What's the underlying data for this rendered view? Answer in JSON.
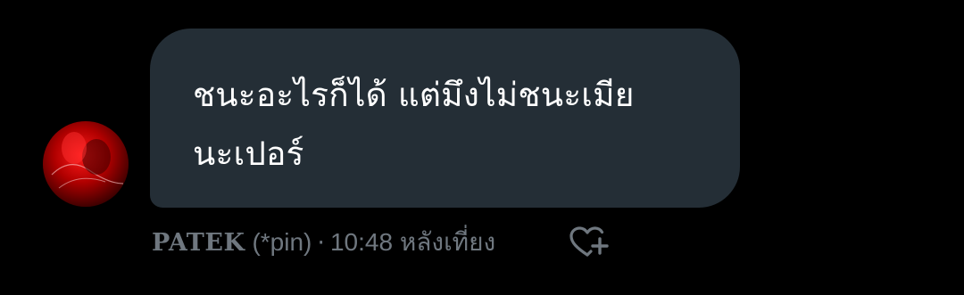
{
  "message": {
    "text": "ชนะอะไรก็ได้ แต่มึงไม่ชนะเมีย\nนะเปอร์",
    "sender": "PATEK",
    "nickname": "(*pin)",
    "separator": "·",
    "time": "10:48 หลังเที่ยง"
  },
  "icons": {
    "avatar": "profile-photo",
    "react": "heart-plus-icon"
  },
  "colors": {
    "background": "#000000",
    "bubble": "#242e36",
    "text": "#ffffff",
    "meta": "#6f777f"
  }
}
